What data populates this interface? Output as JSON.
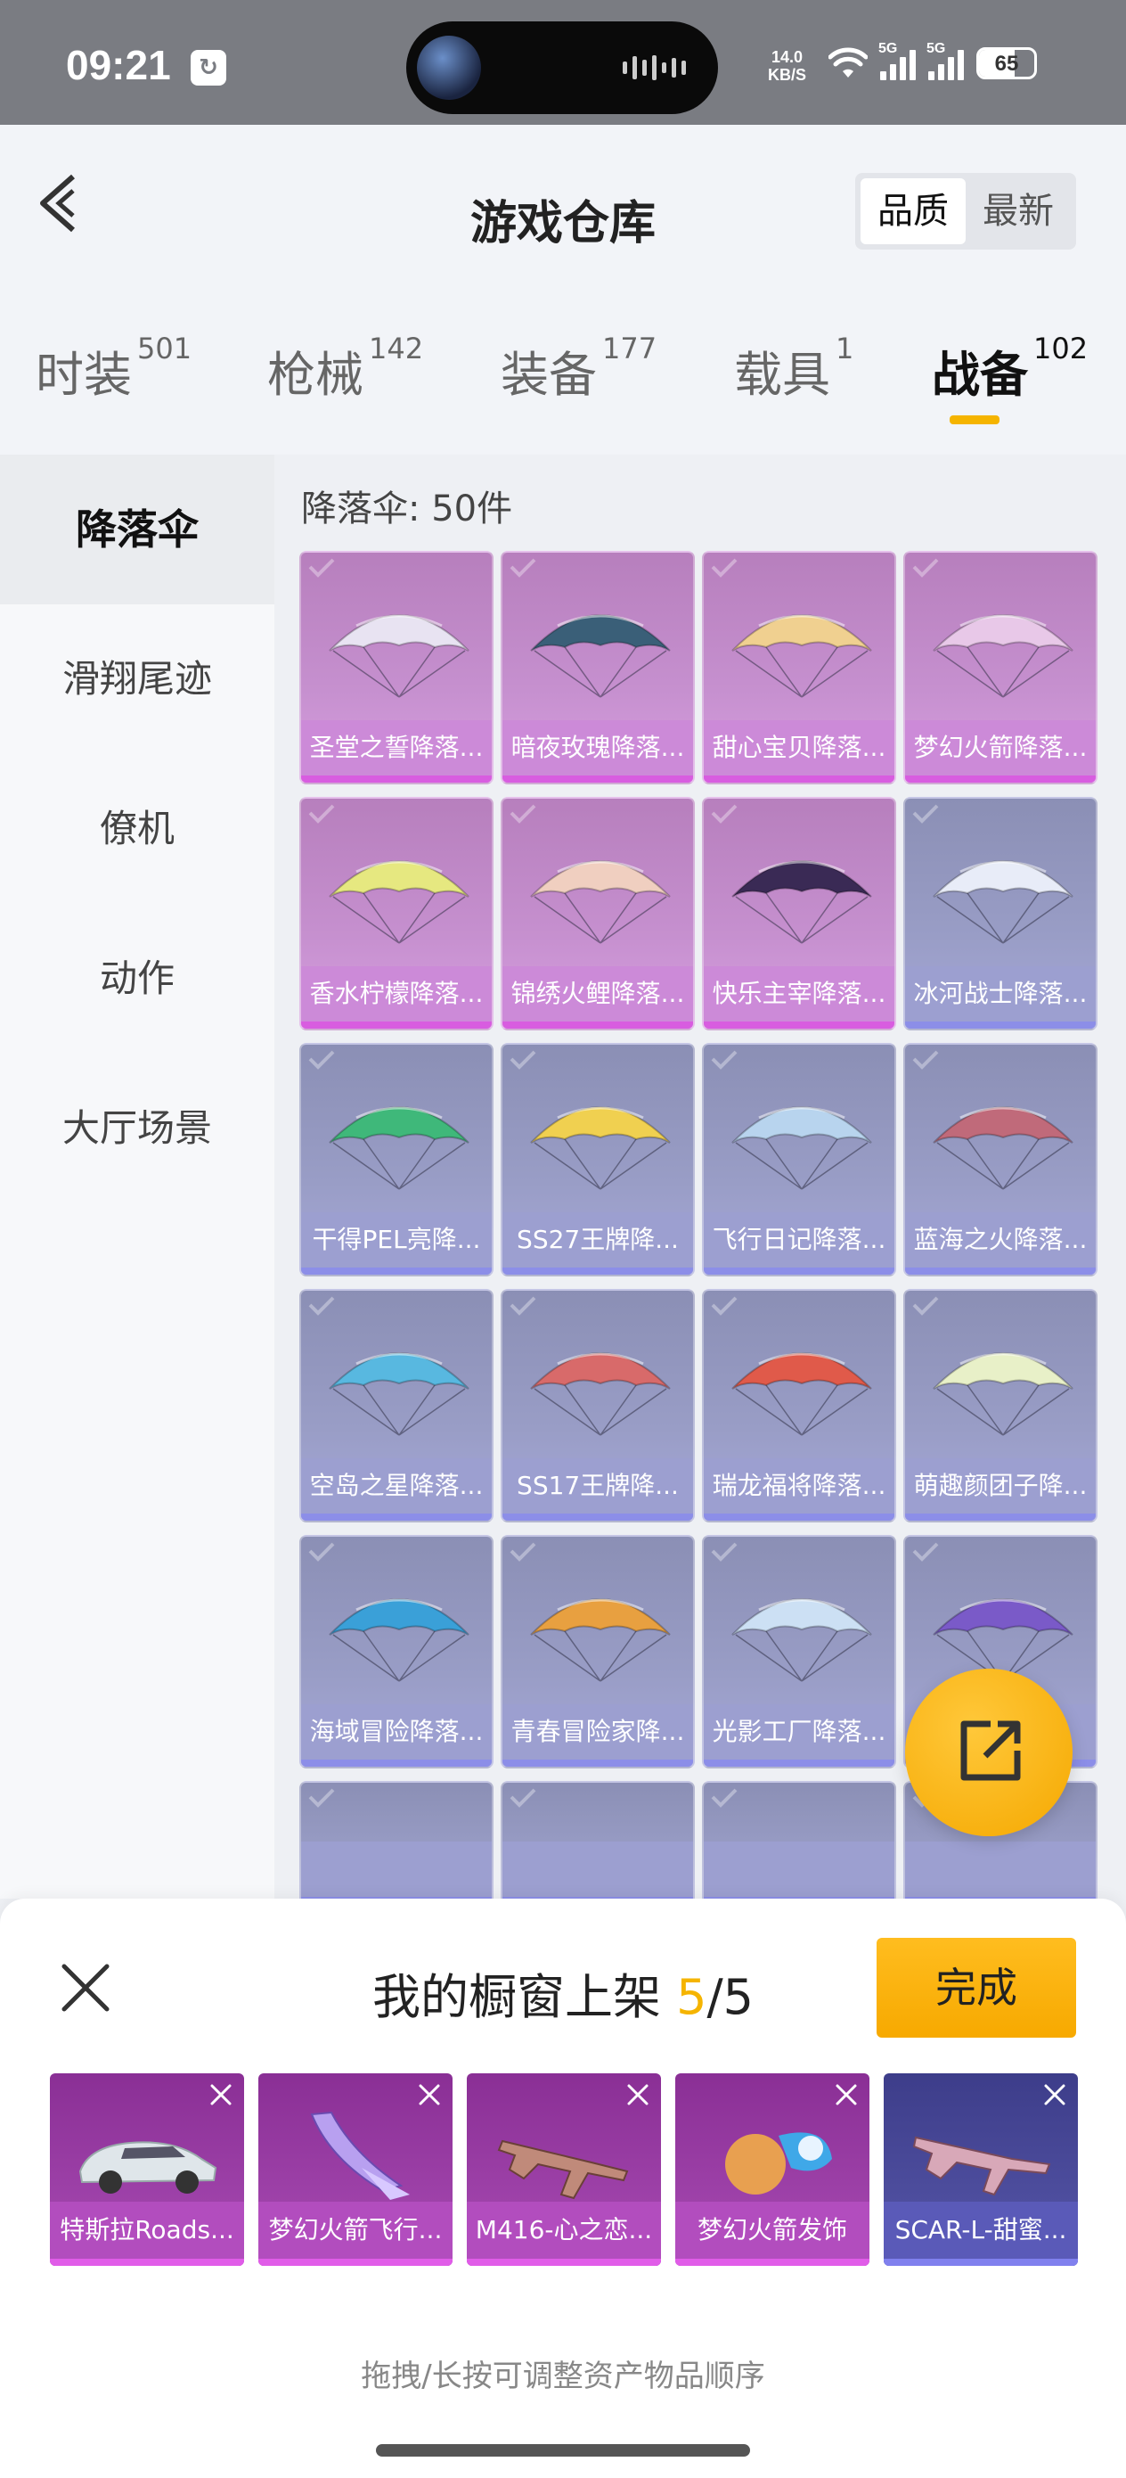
{
  "status_bar": {
    "time": "09:21",
    "net_speed_value": "14.0",
    "net_speed_unit": "KB/S",
    "signal_tag": "5G",
    "battery": "65"
  },
  "header": {
    "title": "游戏仓库",
    "sort": [
      "品质",
      "最新"
    ],
    "sort_active": 0
  },
  "tabs": [
    {
      "label": "时装",
      "count": "501"
    },
    {
      "label": "枪械",
      "count": "142"
    },
    {
      "label": "装备",
      "count": "177"
    },
    {
      "label": "载具",
      "count": "1"
    },
    {
      "label": "战备",
      "count": "102"
    }
  ],
  "active_tab": 4,
  "sidebar": [
    "降落伞",
    "滑翔尾迹",
    "僚机",
    "动作",
    "大厅场景"
  ],
  "sidebar_active": 0,
  "content": {
    "count_label": "降落伞: 50件",
    "items": [
      {
        "name": "圣堂之誓降落...",
        "rarity": "purple",
        "art": "#e8e3f2"
      },
      {
        "name": "暗夜玫瑰降落...",
        "rarity": "purple",
        "art": "#3a5f78"
      },
      {
        "name": "甜心宝贝降落...",
        "rarity": "purple",
        "art": "#f0d090"
      },
      {
        "name": "梦幻火箭降落...",
        "rarity": "purple",
        "art": "#e8c8e8"
      },
      {
        "name": "香水柠檬降落...",
        "rarity": "purple",
        "art": "#e6e880"
      },
      {
        "name": "锦绣火鲤降落...",
        "rarity": "purple",
        "art": "#f0cfc0"
      },
      {
        "name": "快乐主宰降落...",
        "rarity": "purple",
        "art": "#3a2a55"
      },
      {
        "name": "冰河战士降落...",
        "rarity": "blue",
        "art": "#e8ecf8"
      },
      {
        "name": "干得PEL亮降...",
        "rarity": "blue",
        "art": "#3fb87a"
      },
      {
        "name": "SS27王牌降...",
        "rarity": "blue",
        "art": "#f0d050"
      },
      {
        "name": "飞行日记降落...",
        "rarity": "blue",
        "art": "#b8d4ee"
      },
      {
        "name": "蓝海之火降落...",
        "rarity": "blue",
        "art": "#c06a7a"
      },
      {
        "name": "空岛之星降落...",
        "rarity": "blue",
        "art": "#58b8e0"
      },
      {
        "name": "SS17王牌降...",
        "rarity": "blue",
        "art": "#d86a6a"
      },
      {
        "name": "瑞龙福将降落...",
        "rarity": "blue",
        "art": "#e05a4a"
      },
      {
        "name": "萌趣颜团子降...",
        "rarity": "blue",
        "art": "#e8f0c8"
      },
      {
        "name": "海域冒险降落...",
        "rarity": "blue",
        "art": "#3aa0d8"
      },
      {
        "name": "青春冒险家降...",
        "rarity": "blue",
        "art": "#e8a040"
      },
      {
        "name": "光影工厂降落...",
        "rarity": "blue",
        "art": "#cce0f4"
      },
      {
        "name": "",
        "rarity": "blue",
        "art": "#7a5ac8"
      },
      {
        "name": "",
        "rarity": "blue",
        "art": "#d86a8a"
      },
      {
        "name": "",
        "rarity": "blue",
        "art": "#e8e0ee"
      },
      {
        "name": "",
        "rarity": "blue",
        "art": "#c85a3a"
      },
      {
        "name": "",
        "rarity": "blue",
        "art": "#e8a8c8"
      }
    ]
  },
  "sheet": {
    "title_prefix": "我的橱窗上架 ",
    "current": "5",
    "total": "/5",
    "done_label": "完成",
    "items": [
      {
        "name": "特斯拉Roads...",
        "rarity": "purple",
        "kind": "car"
      },
      {
        "name": "梦幻火箭飞行...",
        "rarity": "purple",
        "kind": "glider"
      },
      {
        "name": "M416-心之恋...",
        "rarity": "purple",
        "kind": "gun"
      },
      {
        "name": "梦幻火箭发饰",
        "rarity": "purple",
        "kind": "hair"
      },
      {
        "name": "SCAR-L-甜蜜...",
        "rarity": "blue",
        "kind": "gun2"
      }
    ],
    "hint": "拖拽/长按可调整资产物品顺序"
  },
  "colors": {
    "accent": "#f5b400",
    "epic": "#d85de0",
    "rare": "#8c8ee8"
  }
}
